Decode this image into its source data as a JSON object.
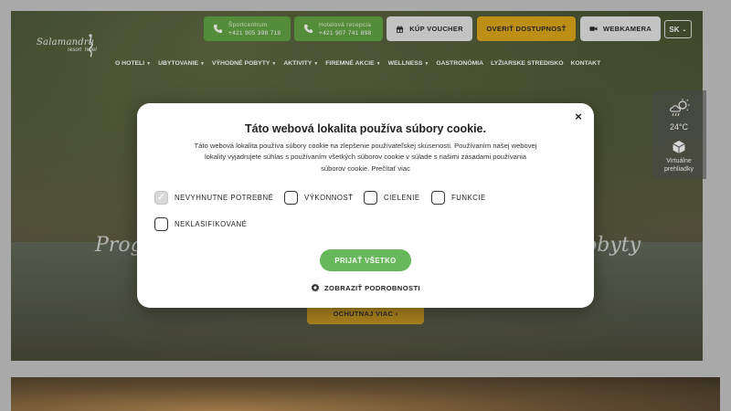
{
  "header": {
    "logo": {
      "name": "Salamandra",
      "sub": "resort",
      "sub2": "hotel"
    },
    "sport": {
      "title": "Športcentrum",
      "phone": "+421 905 398 718"
    },
    "hotel": {
      "title": "Hotelová recepcia",
      "phone": "+421 907 741 898"
    },
    "voucher_label": "KÚP VOUCHER",
    "availability_label": "OVERIŤ DOSTUPNOSŤ",
    "webcam_label": "WEBKAMERA",
    "lang": "SK"
  },
  "nav": {
    "items": [
      {
        "label": "O HOTELI",
        "caret": true
      },
      {
        "label": "UBYTOVANIE",
        "caret": true
      },
      {
        "label": "VÝHODNÉ POBYTY",
        "caret": true
      },
      {
        "label": "AKTIVITY",
        "caret": true
      },
      {
        "label": "FIREMNÉ AKCIE",
        "caret": true
      },
      {
        "label": "WELLNESS",
        "caret": true
      },
      {
        "label": "GASTRONÓMIA",
        "caret": false
      },
      {
        "label": "LYŽIARSKE STREDISKO",
        "caret": false
      },
      {
        "label": "KONTAKT",
        "caret": false
      }
    ]
  },
  "weather": {
    "temp": "24°C",
    "vr_line1": "Virtuálne",
    "vr_line2": "prehliadky"
  },
  "hero": {
    "tagline_left": "Prog",
    "tagline_right": "obyty",
    "cta_label": "OCHUTNAJ VIAC"
  },
  "cookie": {
    "title": "Táto webová lokalita používa súbory cookie.",
    "body": "Táto webová lokalita používa súbory cookie na zlepšenie používateľskej skúsenosti. Používaním našej webovej lokality vyjadrujete súhlas s používaním všetkých súborov cookie v súlade s našimi zásadami používania súborov cookie. Prečítať viac",
    "options": [
      {
        "label": "NEVYHNUTNE POTREBNÉ",
        "checked": true
      },
      {
        "label": "VÝKONNOSŤ",
        "checked": false
      },
      {
        "label": "CIELENIE",
        "checked": false
      },
      {
        "label": "FUNKCIE",
        "checked": false
      },
      {
        "label": "NEKLASIFIKOVANÉ",
        "checked": false
      }
    ],
    "accept_label": "PRIJAŤ VŠETKO",
    "details_label": "ZOBRAZIŤ PODROBNOSTI",
    "close_symbol": "×"
  },
  "colors": {
    "green": "#5fa43e",
    "accept_green": "#67b85a",
    "gold": "#e0a614"
  }
}
